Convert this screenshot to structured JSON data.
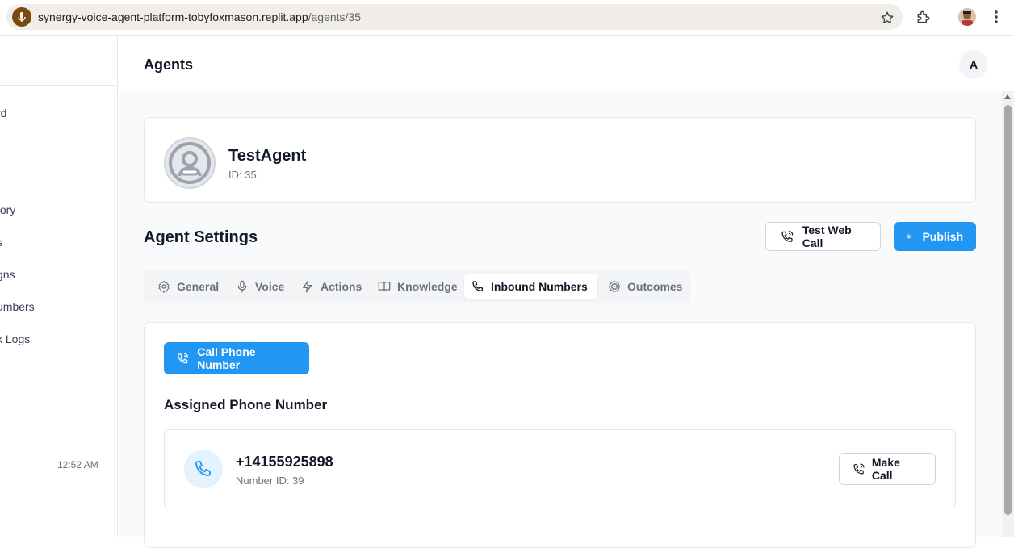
{
  "browser": {
    "url_domain": "synergy-voice-agent-platform-tobyfoxmason.replit.app",
    "url_path": "/agents/35"
  },
  "sidebar": {
    "items": [
      {
        "label": "rd"
      },
      {
        "label": "tory"
      },
      {
        "label": "s"
      },
      {
        "label": "gns"
      },
      {
        "label": "umbers"
      },
      {
        "label": "k Logs"
      }
    ],
    "time": "12:52 AM"
  },
  "header": {
    "title": "Agents",
    "avatar_initial": "A"
  },
  "agent": {
    "name": "TestAgent",
    "id_text": "ID: 35"
  },
  "settings": {
    "title": "Agent Settings",
    "test_call_label": "Test Web Call",
    "publish_label": "Publish"
  },
  "tabs": [
    {
      "label": "General",
      "icon": "gear-icon",
      "active": false
    },
    {
      "label": "Voice",
      "icon": "microphone-icon",
      "active": false
    },
    {
      "label": "Actions",
      "icon": "lightning-icon",
      "active": false
    },
    {
      "label": "Knowledge",
      "icon": "book-icon",
      "active": false
    },
    {
      "label": "Inbound Numbers",
      "icon": "phone-icon",
      "active": true
    },
    {
      "label": "Outcomes",
      "icon": "target-icon",
      "active": false
    }
  ],
  "inbound": {
    "call_button_label": "Call Phone Number",
    "assigned_title": "Assigned Phone Number",
    "phone_number": "+14155925898",
    "number_id_text": "Number ID: 39",
    "make_call_label": "Make Call"
  },
  "colors": {
    "primary": "#2196f3",
    "tab_bg": "#f3f4f6",
    "phone_circle_bg": "#e3f2fd"
  }
}
